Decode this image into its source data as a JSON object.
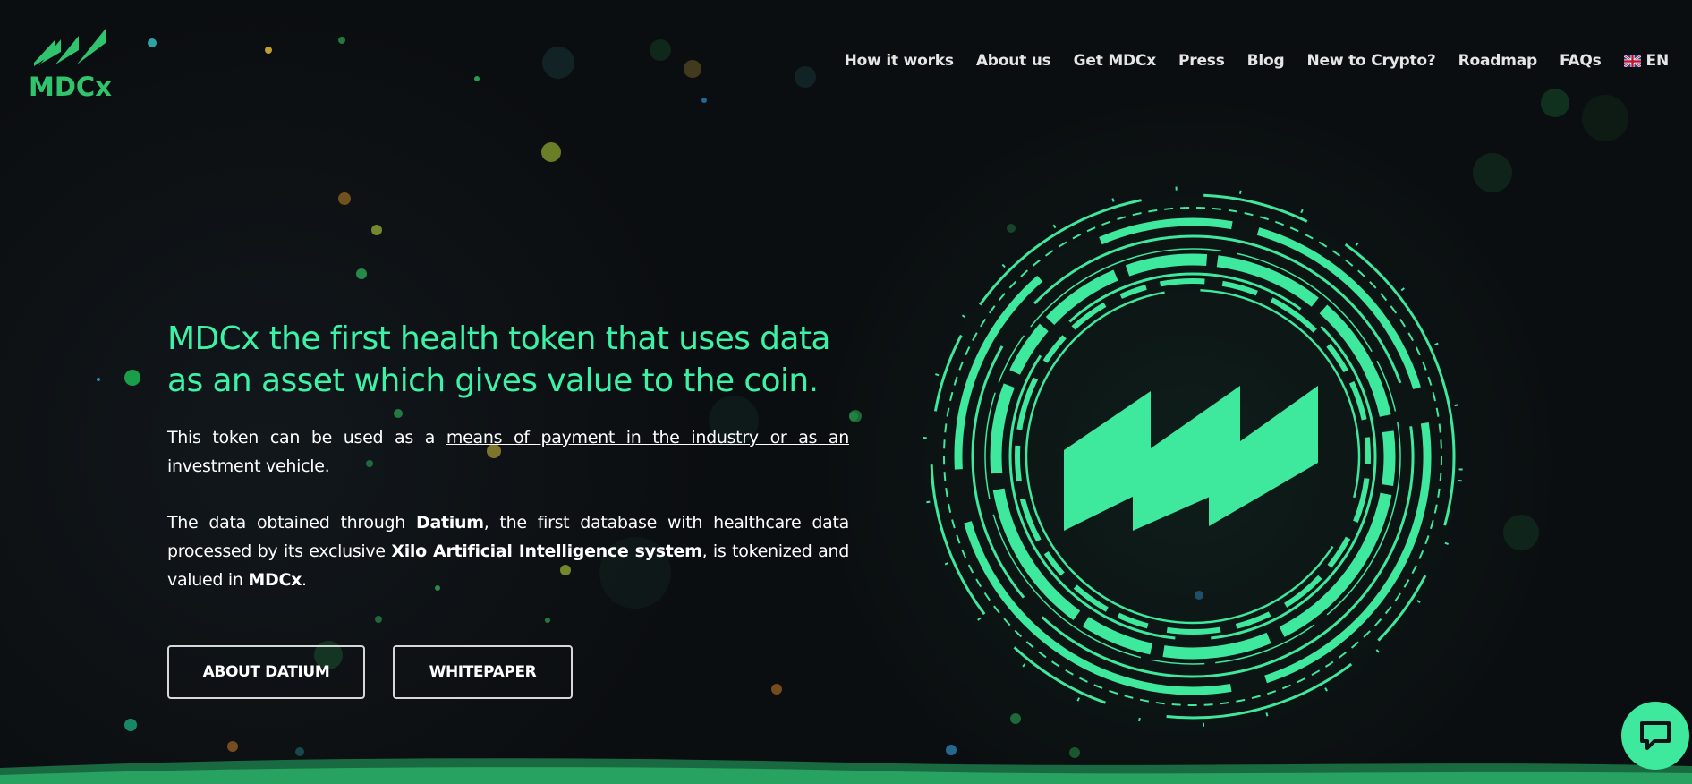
{
  "brand": {
    "name": "MDCx",
    "accent": "#3cf2a6",
    "logo_color": "#2fc46d",
    "background": "#0b0e10"
  },
  "nav": {
    "items": [
      {
        "label": "How it works"
      },
      {
        "label": "About us"
      },
      {
        "label": "Get MDCx"
      },
      {
        "label": "Press"
      },
      {
        "label": "Blog"
      },
      {
        "label": "New to Crypto?"
      },
      {
        "label": "Roadmap"
      },
      {
        "label": "FAQs"
      }
    ],
    "language": {
      "label": "EN",
      "flag_icon": "uk-flag-icon"
    }
  },
  "hero": {
    "headline": "MDCx the first health token that uses data as an asset which gives value to the coin.",
    "para1_prefix": "This token can be used as a ",
    "para1_link": "means of payment in the industry or as an investment vehicle.",
    "para2_part1": "The data obtained through ",
    "para2_bold1": "Datium",
    "para2_part2": ", the first database with healthcare data processed by its exclusive ",
    "para2_bold2": "Xilo Artificial Intelligence system",
    "para2_part3": ", is tokenized and valued in ",
    "para2_bold3": "MDCx",
    "para2_part4": "."
  },
  "buttons": {
    "about_datium": "ABOUT DATIUM",
    "whitepaper": "WHITEPAPER"
  },
  "chat": {
    "icon": "chat-bubble-icon"
  }
}
